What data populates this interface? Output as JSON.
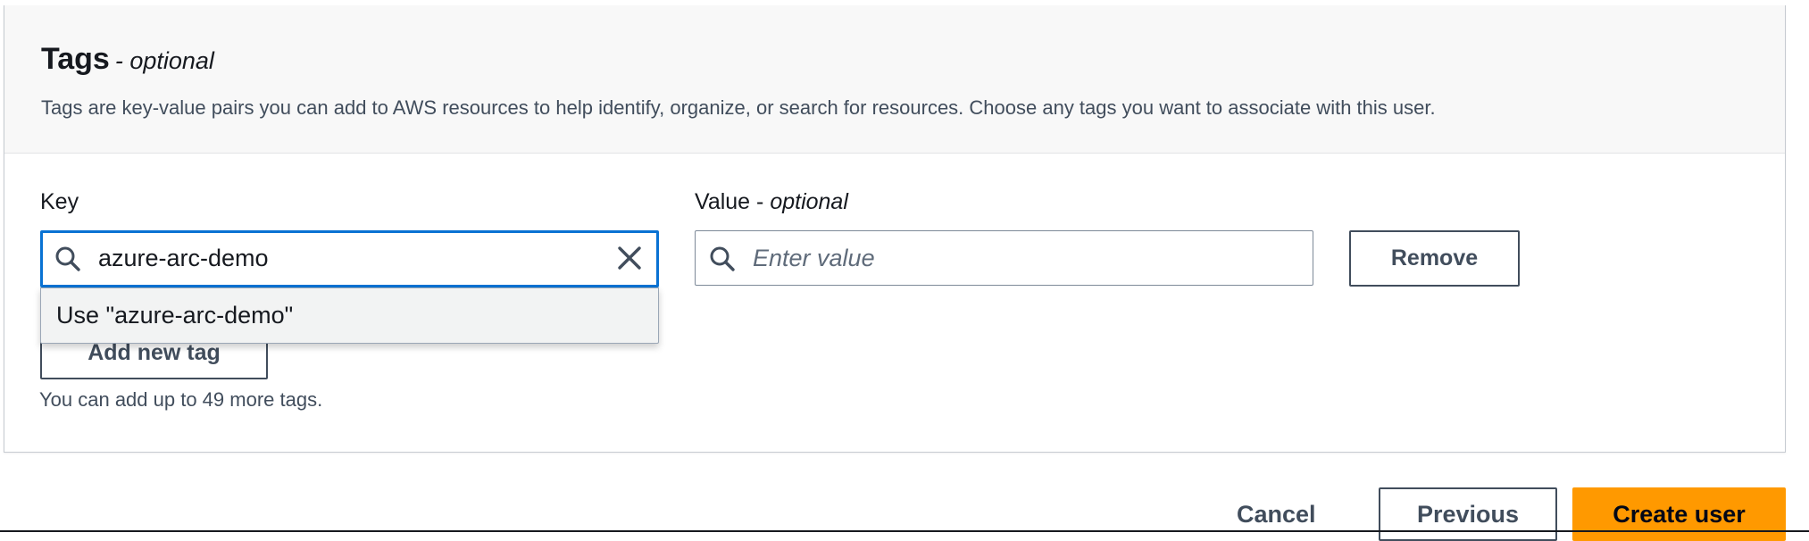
{
  "section": {
    "title": "Tags",
    "title_suffix": "- optional",
    "description": "Tags are key-value pairs you can add to AWS resources to help identify, organize, or search for resources. Choose any tags you want to associate with this user."
  },
  "key_field": {
    "label": "Key",
    "value": "azure-arc-demo",
    "icon": "search-icon",
    "clear_icon": "close-icon"
  },
  "value_field": {
    "label": "Value",
    "label_suffix": "optional",
    "placeholder": "Enter value",
    "icon": "search-icon"
  },
  "remove_button": {
    "label": "Remove"
  },
  "suggestion": {
    "label": "Use \"azure-arc-demo\""
  },
  "add_tag_button": {
    "label": "Add new tag"
  },
  "hint": "You can add up to 49 more tags.",
  "footer": {
    "cancel_label": "Cancel",
    "previous_label": "Previous",
    "create_label": "Create user"
  },
  "colors": {
    "focus_border": "#0972d3",
    "primary_button": "#ff9900",
    "text": "#16191f",
    "secondary_text": "#414d5c"
  }
}
